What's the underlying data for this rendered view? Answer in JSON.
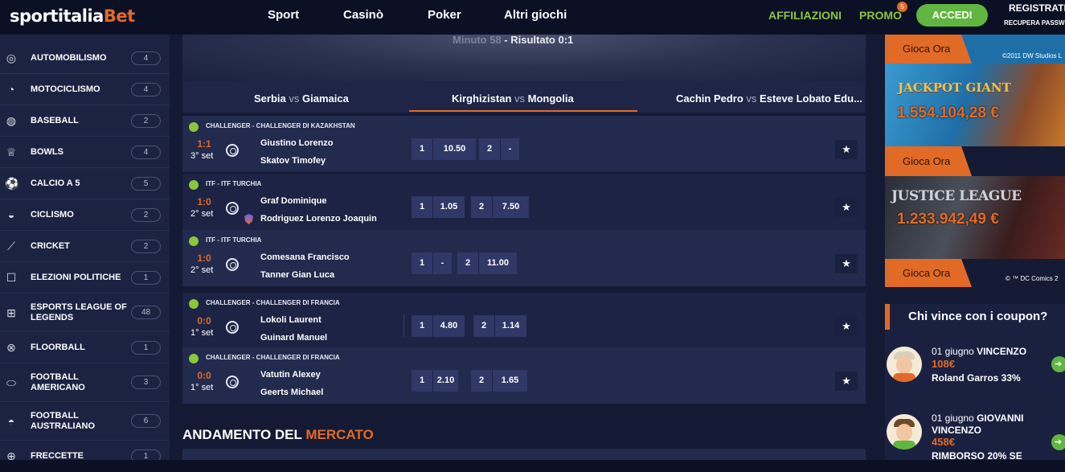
{
  "header": {
    "logo_part1": "sportitalia",
    "logo_part2": "Bet",
    "nav": [
      "Sport",
      "Casinò",
      "Poker",
      "Altri giochi"
    ],
    "affiliazioni": "AFFILIAZIONI",
    "promo": "PROMO",
    "promo_badge": "5",
    "accedi": "ACCEDI",
    "registrati": "REGISTRATI",
    "recupera": "RECUPERA PASSWORD"
  },
  "sidebar": {
    "items": [
      {
        "label": "AUTOMOBILISMO",
        "count": "4",
        "icon": "steering-wheel-icon",
        "glyph": "◎"
      },
      {
        "label": "MOTOCICLISMO",
        "count": "4",
        "icon": "helmet-icon",
        "glyph": "◔"
      },
      {
        "label": "BASEBALL",
        "count": "2",
        "icon": "baseball-icon",
        "glyph": "◍"
      },
      {
        "label": "BOWLS",
        "count": "4",
        "icon": "trophy-icon",
        "glyph": "♕"
      },
      {
        "label": "CALCIO A 5",
        "count": "5",
        "icon": "soccer-ball-icon",
        "glyph": "⚽"
      },
      {
        "label": "CICLISMO",
        "count": "2",
        "icon": "cycling-helmet-icon",
        "glyph": "◒"
      },
      {
        "label": "CRICKET",
        "count": "2",
        "icon": "cricket-bat-icon",
        "glyph": "⟋"
      },
      {
        "label": "ELEZIONI POLITICHE",
        "count": "1",
        "icon": "ballot-box-icon",
        "glyph": "☐"
      },
      {
        "label": "ESPORTS LEAGUE OF LEGENDS",
        "count": "48",
        "icon": "gamepad-icon",
        "glyph": "⊞"
      },
      {
        "label": "FLOORBALL",
        "count": "1",
        "icon": "floorball-icon",
        "glyph": "⊗"
      },
      {
        "label": "FOOTBALL AMERICANO",
        "count": "3",
        "icon": "american-football-icon",
        "glyph": "⬭"
      },
      {
        "label": "FOOTBALL AUSTRALIANO",
        "count": "6",
        "icon": "australian-football-icon",
        "glyph": "◓"
      },
      {
        "label": "FRECCETTE",
        "count": "1",
        "icon": "darts-icon",
        "glyph": "⊕"
      }
    ]
  },
  "banner": {
    "minute": "Minuto 58",
    "result_label": "- Risultato",
    "score": "0:1"
  },
  "tabs": [
    {
      "home": "Serbia",
      "vs": "vs",
      "away": "Giamaica"
    },
    {
      "home": "Kirghizistan",
      "vs": "vs",
      "away": "Mongolia"
    },
    {
      "home": "Cachin Pedro",
      "vs": "vs",
      "away": "Esteve Lobato Edu..."
    }
  ],
  "matches": [
    {
      "league": "CHALLENGER - CHALLENGER DI KAZAKHSTAN",
      "score": "1:1",
      "set": "3° set",
      "p1": "Giustino Lorenzo",
      "p2": "Skatov Timofey",
      "o1k": "1",
      "o1v": "10.50",
      "o2k": "2",
      "o2v": "-"
    },
    {
      "league": "ITF - ITF TURCHIA",
      "score": "1:0",
      "set": "2° set",
      "p1": "Graf Dominique",
      "p2": "Rodriguez Lorenzo Joaquin",
      "o1k": "1",
      "o1v": "1.05",
      "o2k": "2",
      "o2v": "7.50"
    },
    {
      "league": "ITF - ITF TURCHIA",
      "score": "1:0",
      "set": "2° set",
      "p1": "Comesana Francisco",
      "p2": "Tanner Gian Luca",
      "o1k": "1",
      "o1v": "-",
      "o2k": "2",
      "o2v": "11.00"
    },
    {
      "league": "CHALLENGER - CHALLENGER DI FRANCIA",
      "score": "0:0",
      "set": "1° set",
      "p1": "Lokoli Laurent",
      "p2": "Guinard Manuel",
      "o1k": "1",
      "o1v": "4.80",
      "o2k": "2",
      "o2v": "1.14"
    },
    {
      "league": "CHALLENGER - CHALLENGER DI FRANCIA",
      "score": "0:0",
      "set": "1° set",
      "p1": "Vatutin Alexey",
      "p2": "Geerts Michael",
      "o1k": "1",
      "o1v": "2.10",
      "o2k": "2",
      "o2v": "1.65"
    }
  ],
  "andamento": {
    "part1": "ANDAMENTO DEL",
    "part2": "MERCATO"
  },
  "right": {
    "gioca_ora": "Gioca Ora",
    "copyright1": "©2011 DW Studios L",
    "jackpot_title": "JACKPOT GIANT",
    "jackpot_amount": "1.554.104,28 €",
    "justice_title": "JUSTICE LEAGUE",
    "justice_amount": "1.233.942,49 €",
    "copyright2": "© ™ DC Comics 2",
    "coupon_title": "Chi vince con i coupon?",
    "winners": [
      {
        "date": "01 giugno",
        "name": "VINCENZO",
        "amount": "108€",
        "desc": "Roland Garros 33%"
      },
      {
        "date": "01 giugno",
        "name": "GIOVANNI VINCENZO",
        "name_line1": "GIOVANNI",
        "name_line2": "VINCENZO",
        "amount": "458€",
        "desc": "RIMBORSO 20% SE"
      }
    ]
  },
  "colors": {
    "accent": "#e26a27",
    "green": "#5fb640",
    "bg": "#141a33"
  }
}
